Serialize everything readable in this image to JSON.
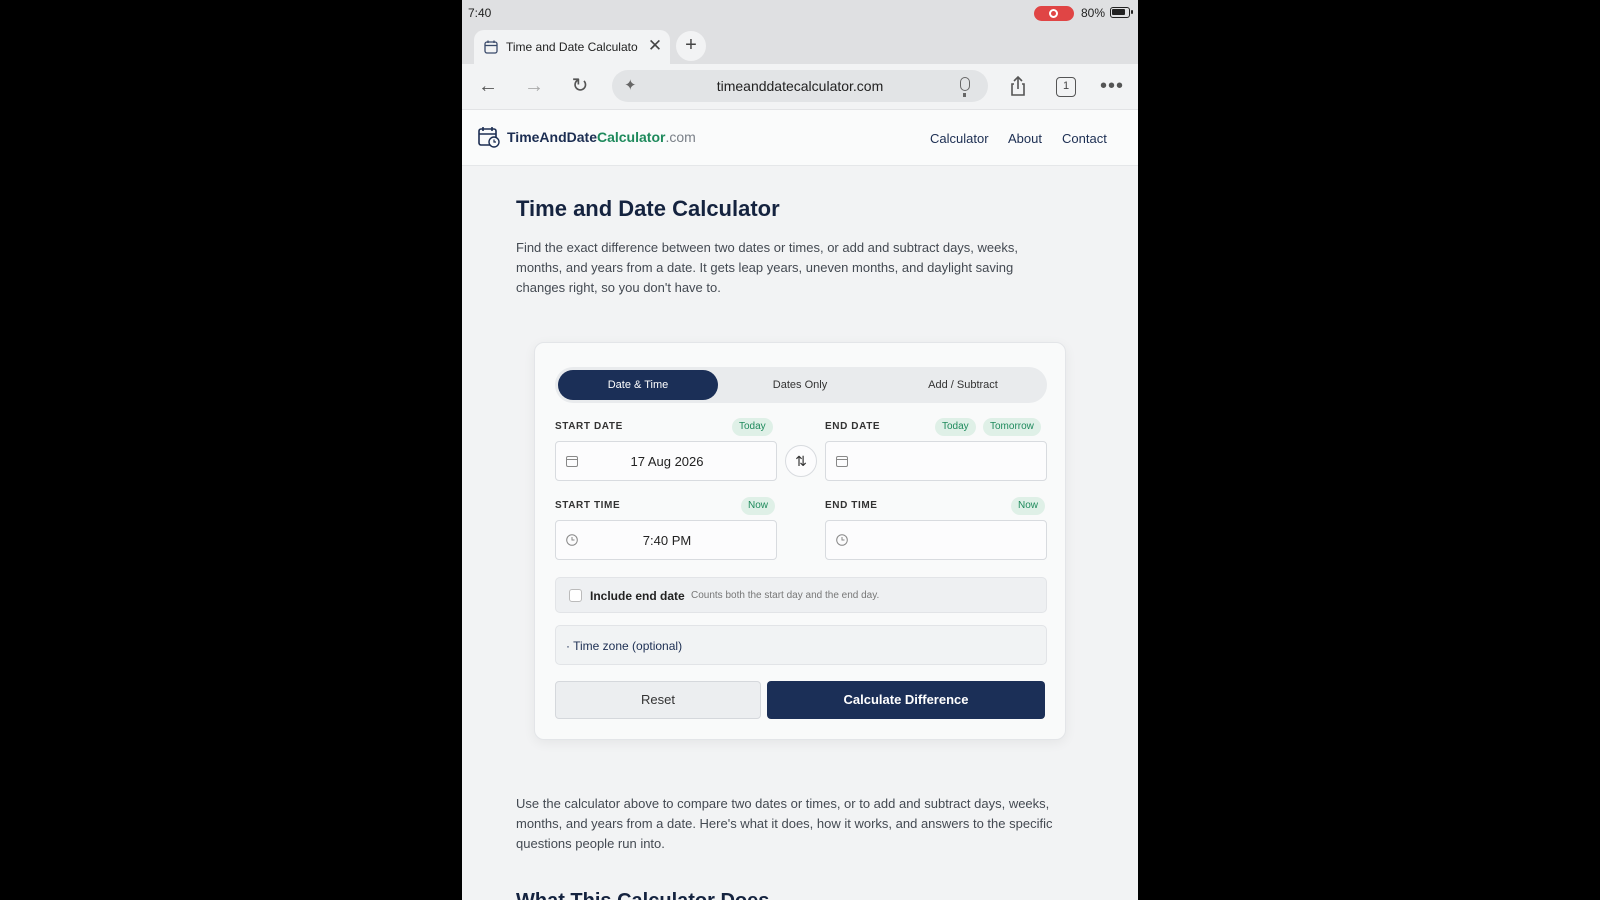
{
  "status_bar": {
    "time": "7:40",
    "battery": "80%"
  },
  "browser": {
    "tab_title": "Time and Date Calculato",
    "address": "timeanddatecalculator.com",
    "tab_count": "1"
  },
  "site": {
    "logo": {
      "part1": "TimeAndDate",
      "part2": "Calculator",
      "part3": ".com"
    },
    "nav": [
      "Calculator",
      "About",
      "Contact"
    ]
  },
  "page": {
    "title": "Time and Date Calculator",
    "intro": "Find the exact difference between two dates or times, or add and subtract days, weeks, months, and years from a date. It gets leap years, uneven months, and daylight saving changes right, so you don't have to.",
    "outro": "Use the calculator above to compare two dates or times, or to add and subtract days, weeks, months, and years from a date. Here's what it does, how it works, and answers to the specific questions people run into.",
    "next_heading": "What This Calculator Does"
  },
  "calculator": {
    "tabs": [
      "Date & Time",
      "Dates Only",
      "Add / Subtract"
    ],
    "active_tab": "Date & Time",
    "start_date": {
      "label": "START DATE",
      "chip_today": "Today",
      "value": "17 Aug 2026"
    },
    "end_date": {
      "label": "END DATE",
      "chip_today": "Today",
      "chip_tomorrow": "Tomorrow",
      "value": ""
    },
    "start_time": {
      "label": "START TIME",
      "chip_now": "Now",
      "value": "7:40 PM"
    },
    "end_time": {
      "label": "END TIME",
      "chip_now": "Now",
      "value": ""
    },
    "include_end": {
      "label": "Include end date",
      "hint": "Counts both the start day and the end day.",
      "checked": false
    },
    "timezone_label": "Time zone (optional)",
    "reset_label": "Reset",
    "calculate_label": "Calculate Difference"
  },
  "colors": {
    "navy": "#1b2f57",
    "green": "#1e8a5c",
    "chip_bg": "#dff0e7"
  },
  "icons": [
    "record-icon",
    "battery-icon",
    "calendar-favicon",
    "close-icon",
    "plus-icon",
    "back-icon",
    "forward-icon",
    "reload-icon",
    "sparkle-icon",
    "mic-icon",
    "share-icon",
    "tabs-icon",
    "more-icon",
    "calendar-icon",
    "clock-icon",
    "swap-icon"
  ]
}
